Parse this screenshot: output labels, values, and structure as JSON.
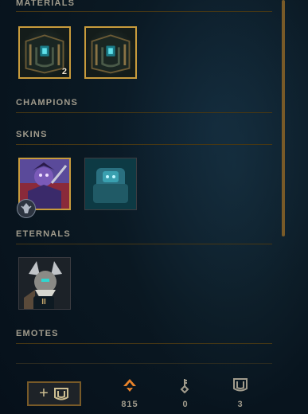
{
  "sections": {
    "materials": "MATERIALS",
    "champions": "CHAMPIONS",
    "skins": "SKINS",
    "eternals": "ETERNALS",
    "emotes": "EMOTES"
  },
  "materials": [
    {
      "name": "hextech-chest",
      "count": "2"
    },
    {
      "name": "hextech-chest",
      "count": ""
    }
  ],
  "eternals": [
    {
      "name": "eternal-series",
      "tier": "II"
    }
  ],
  "footer": {
    "add_button_icon": "plus-chest-icon",
    "currencies": [
      {
        "icon": "orange-essence-icon",
        "value": "815"
      },
      {
        "icon": "key-icon",
        "value": "0"
      },
      {
        "icon": "chest-icon",
        "value": "3"
      }
    ]
  },
  "colors": {
    "gold": "#c89b3c",
    "label": "#a09b8c",
    "orange_essence": "#e8822a",
    "background": "#0a1822"
  }
}
